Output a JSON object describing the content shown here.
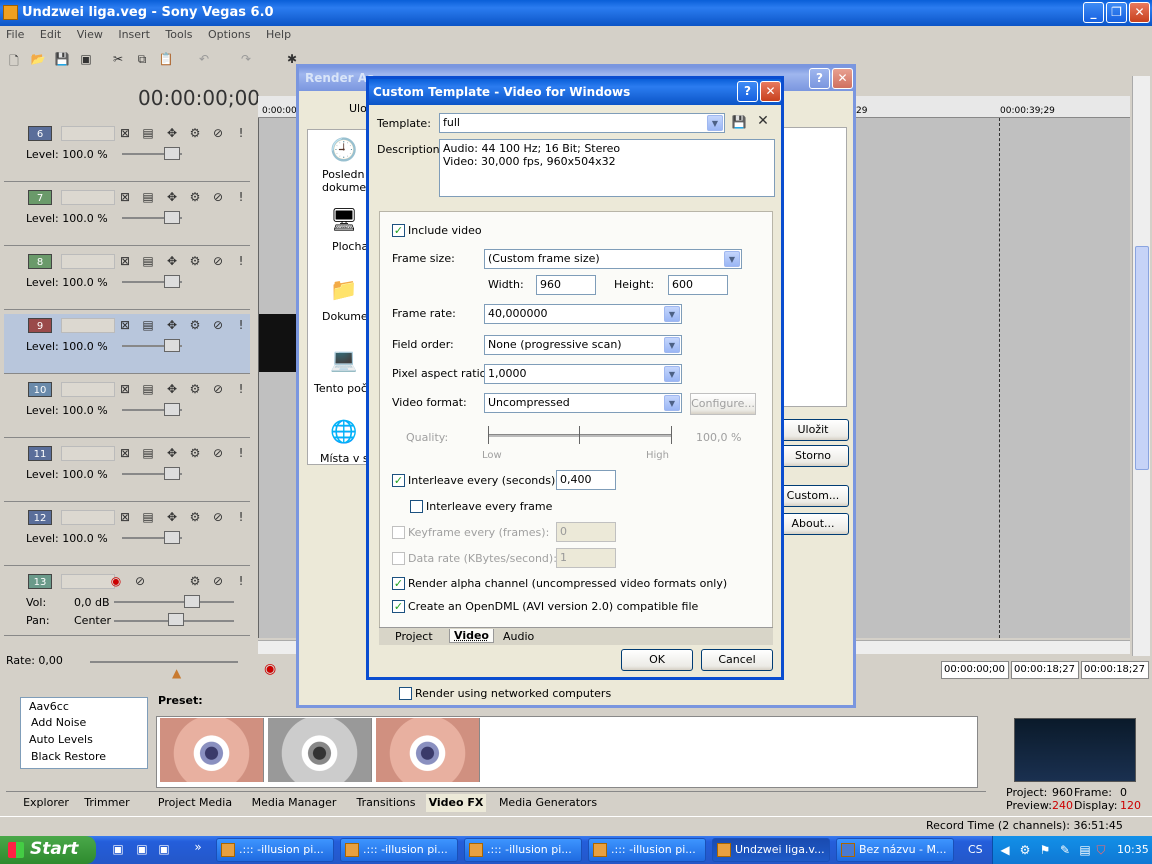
{
  "app": {
    "title": "Undzwei liga.veg - Sony Vegas 6.0",
    "time_display": "00:00:00;00",
    "rate_label": "Rate: 0,00"
  },
  "menu": [
    "File",
    "Edit",
    "View",
    "Insert",
    "Tools",
    "Options",
    "Help"
  ],
  "tracks": [
    {
      "num": "6",
      "level": "Level: 100.0 %",
      "color": "#5a6e9a"
    },
    {
      "num": "7",
      "level": "Level: 100.0 %",
      "color": "#6a9a6a"
    },
    {
      "num": "8",
      "level": "Level: 100.0 %",
      "color": "#6a9a6a"
    },
    {
      "num": "9",
      "level": "Level: 100.0 %",
      "color": "#9a4a4a"
    },
    {
      "num": "10",
      "level": "Level: 100.0 %",
      "color": "#6a8aaa"
    },
    {
      "num": "11",
      "level": "Level: 100.0 %",
      "color": "#5a6e9a"
    },
    {
      "num": "12",
      "level": "Level: 100.0 %",
      "color": "#5a6e9a"
    }
  ],
  "audio_track": {
    "num": "13",
    "vol_label": "Vol:",
    "vol_value": "0,0 dB",
    "pan_label": "Pan:",
    "pan_value": "Center"
  },
  "timeline": {
    "ruler_start": "0:00:00",
    "ruler_mid": "29",
    "ruler_end": "00:00:39;29",
    "times": [
      "00:00:00;00",
      "00:00:18;27",
      "00:00:18;27"
    ]
  },
  "render_as": {
    "title": "Render As",
    "save_in": "Ulož",
    "places": [
      "Posledn dokumen",
      "Plocha",
      "Dokumen",
      "Tento počí",
      "Místa v s"
    ],
    "buttons": {
      "save": "Uložit",
      "cancel": "Storno",
      "custom": "Custom...",
      "about": "About..."
    },
    "networked": "Render using networked computers"
  },
  "custom": {
    "title": "Custom Template - Video for Windows",
    "template_label": "Template:",
    "template_value": "full",
    "description_label": "Description:",
    "description_lines": [
      "Audio: 44 100 Hz; 16 Bit; Stereo",
      "Video: 30,000 fps, 960x504x32"
    ],
    "include_video": "Include video",
    "frame_size_label": "Frame size:",
    "frame_size_value": "(Custom frame size)",
    "width_label": "Width:",
    "width_value": "960",
    "height_label": "Height:",
    "height_value": "600",
    "frame_rate_label": "Frame rate:",
    "frame_rate_value": "40,000000",
    "field_order_label": "Field order:",
    "field_order_value": "None (progressive scan)",
    "par_label": "Pixel aspect ratio:",
    "par_value": "1,0000",
    "video_format_label": "Video format:",
    "video_format_value": "Uncompressed",
    "configure": "Configure...",
    "quality_label": "Quality:",
    "quality_value": "100,0 %",
    "quality_low": "Low",
    "quality_high": "High",
    "interleave_label": "Interleave every (seconds):",
    "interleave_value": "0,400",
    "interleave_frame": "Interleave every frame",
    "keyframe_label": "Keyframe every (frames):",
    "keyframe_value": "0",
    "datarate_label": "Data rate (KBytes/second):",
    "datarate_value": "1",
    "alpha": "Render alpha channel (uncompressed video formats only)",
    "opendml": "Create an OpenDML (AVI version 2.0) compatible file",
    "tabs": [
      "Project",
      "Video",
      "Audio"
    ],
    "ok": "OK",
    "cancel": "Cancel"
  },
  "fx": {
    "items": [
      "Aav6cc",
      "Add Noise",
      "Auto Levels",
      "Black Restore"
    ],
    "preset_label": "Preset:"
  },
  "bottom_tabs": [
    "Explorer",
    "Trimmer",
    "Project Media",
    "Media Manager",
    "Transitions",
    "Video FX",
    "Media Generators"
  ],
  "preview": {
    "project_label": "Project:",
    "project_value": "960",
    "frame_label": "Frame:",
    "frame_value": "0",
    "preview_label": "Preview:",
    "preview_value": "240",
    "display_label": "Display:",
    "display_value": "120"
  },
  "status": "Record Time (2 channels): 36:51:45",
  "taskbar": {
    "start": "Start",
    "buttons": [
      ".::: -illusion pi...",
      ".::: -illusion pi...",
      ".::: -illusion pi...",
      ".::: -illusion pi...",
      "Undzwei liga.v...",
      "Bez názvu - M..."
    ],
    "lang": "CS",
    "clock": "10:35"
  }
}
